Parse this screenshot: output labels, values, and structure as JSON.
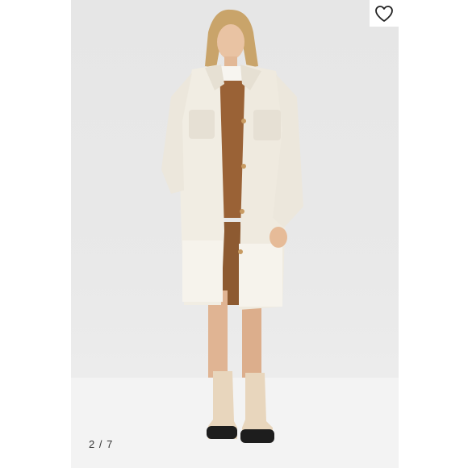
{
  "photo": {
    "alt": "",
    "counter_text": "2 / 7"
  },
  "favorite": {
    "icon": "heart-outline-icon"
  },
  "colors": {
    "backdrop": "#e8e8e8",
    "coat": "#f1ede3",
    "inner_jacket": "#9a6236",
    "boots": "#e8d6bd"
  }
}
